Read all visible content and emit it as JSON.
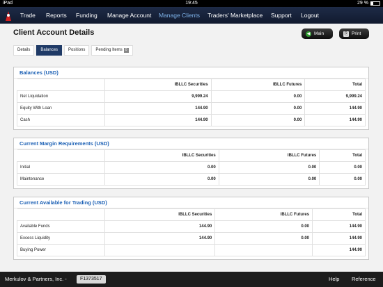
{
  "status_bar": {
    "device": "iPad",
    "time": "19:45",
    "battery": "29 %",
    "battery_fraction": 0.29
  },
  "nav": {
    "items": [
      {
        "label": "Trade"
      },
      {
        "label": "Reports"
      },
      {
        "label": "Funding"
      },
      {
        "label": "Manage Account"
      },
      {
        "label": "Manage Clients",
        "active": true
      },
      {
        "label": "Traders' Marketplace"
      },
      {
        "label": "Support"
      },
      {
        "label": "Logout"
      }
    ]
  },
  "page": {
    "title": "Client Account Details"
  },
  "buttons": {
    "main": "Main",
    "print": "Print"
  },
  "tabs": [
    {
      "label": "Details"
    },
    {
      "label": "Balances",
      "active": true
    },
    {
      "label": "Positions"
    },
    {
      "label": "Pending Items",
      "badge": "0"
    }
  ],
  "columns": [
    "IBLLC Securities",
    "IBLLC Futures",
    "Total"
  ],
  "sections": [
    {
      "title": "Balances (USD)",
      "rows": [
        {
          "label": "Net Liquidation",
          "values": [
            "9,999.24",
            "0.00",
            "9,999.24"
          ]
        },
        {
          "label": "Equity With Loan",
          "values": [
            "144.90",
            "0.00",
            "144.90"
          ]
        },
        {
          "label": "Cash",
          "values": [
            "144.90",
            "0.00",
            "144.90"
          ]
        }
      ]
    },
    {
      "title": "Current Margin Requirements (USD)",
      "rows": [
        {
          "label": "Initial",
          "values": [
            "0.00",
            "0.00",
            "0.00"
          ]
        },
        {
          "label": "Maintenance",
          "values": [
            "0.00",
            "0.00",
            "0.00"
          ]
        }
      ]
    },
    {
      "title": "Current Available for Trading (USD)",
      "rows": [
        {
          "label": "Available Funds",
          "values": [
            "144.90",
            "0.00",
            "144.90"
          ]
        },
        {
          "label": "Excess Liquidity",
          "values": [
            "144.90",
            "0.00",
            "144.90"
          ]
        },
        {
          "label": "Buying Power",
          "values": [
            "",
            "",
            "144.90"
          ]
        }
      ]
    }
  ],
  "footer": {
    "company": "Merkulov & Partners, Inc.",
    "separator": "-",
    "account": "F1373517",
    "help": "Help",
    "reference": "Reference"
  },
  "colors": {
    "nav_bg": "#1e2b47",
    "active_nav": "#7fb4ea",
    "section_title": "#1a5fb4",
    "active_tab": "#1f3a66"
  }
}
